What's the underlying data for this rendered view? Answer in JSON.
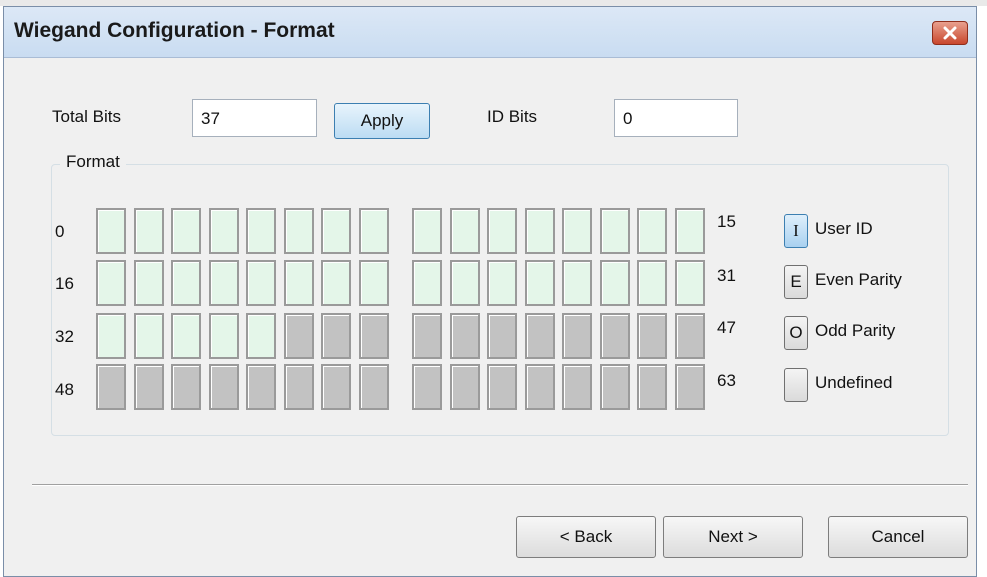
{
  "dialog": {
    "title": "Wiegand Configuration - Format",
    "close_glyph": "✕"
  },
  "fields": {
    "total_bits_label": "Total Bits",
    "total_bits_value": "37",
    "apply_label": "Apply",
    "id_bits_label": "ID Bits",
    "id_bits_value": "0"
  },
  "format": {
    "legend": "Format",
    "row_start_labels": [
      "0",
      "16",
      "32",
      "48"
    ],
    "row_end_labels": [
      "15",
      "31",
      "47",
      "63"
    ],
    "total_cells": 64,
    "defined_cells": 37,
    "defined_type": "user-id",
    "colors": {
      "user_id": "#e4f6e9",
      "undefined": "#c2c2c2"
    }
  },
  "legend_items": [
    {
      "key": "I",
      "label": "User ID"
    },
    {
      "key": "E",
      "label": "Even Parity"
    },
    {
      "key": "O",
      "label": "Odd Parity"
    },
    {
      "key": "",
      "label": "Undefined"
    }
  ],
  "footer": {
    "back_label": "< Back",
    "next_label": "Next >",
    "cancel_label": "Cancel"
  }
}
